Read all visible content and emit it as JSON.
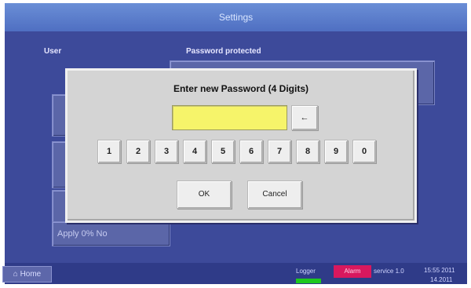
{
  "header": {
    "title": "Settings"
  },
  "background": {
    "user_label": "User",
    "password_label": "Password protected",
    "apply_button": "Apply 0% No"
  },
  "dialog": {
    "title": "Enter new Password (4 Digits)",
    "password_value": "",
    "backspace_label": "←",
    "digits": [
      "1",
      "2",
      "3",
      "4",
      "5",
      "6",
      "7",
      "8",
      "9",
      "0"
    ],
    "ok_label": "OK",
    "cancel_label": "Cancel"
  },
  "statusbar": {
    "home_label": "⌂ Home",
    "item1": "Logger",
    "item2": "Alarm",
    "item3": "service 1.0",
    "time": "15:55 2011",
    "date": "14.2011"
  },
  "colors": {
    "screen_bg": "#3d4a9a",
    "dialog_bg": "#d4d4d4",
    "password_field": "#f6f46a",
    "status_green": "#1fc81f",
    "status_red": "#d9185e"
  }
}
